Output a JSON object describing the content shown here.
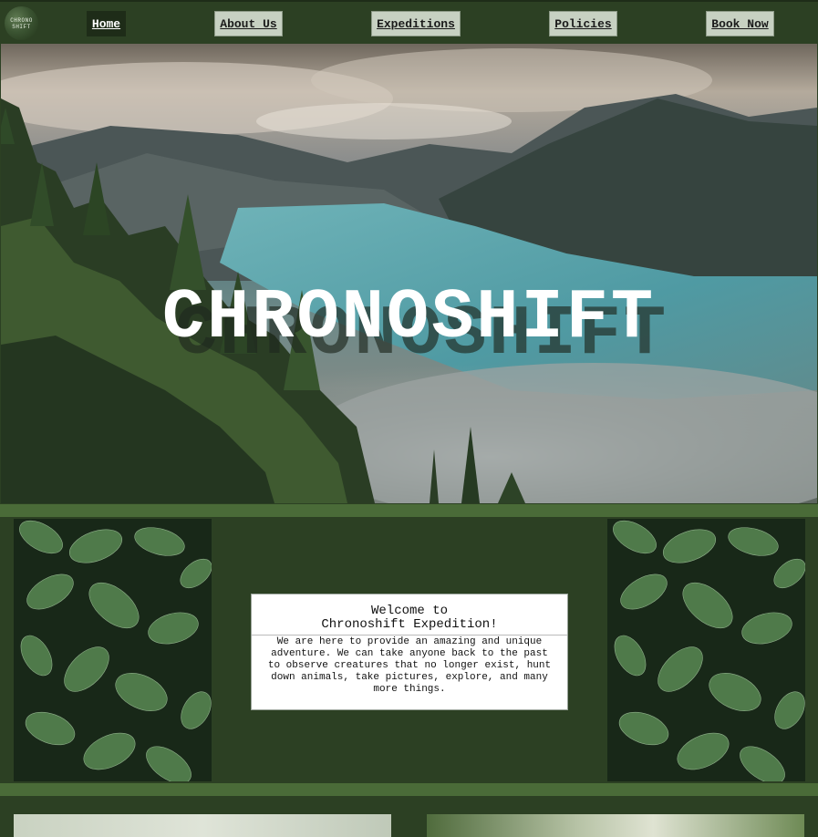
{
  "nav": {
    "logo_line1": "CHRONO",
    "logo_line2": "SHIFT",
    "items": [
      {
        "label": "Home",
        "active": true
      },
      {
        "label": "About Us",
        "active": false
      },
      {
        "label": "Expeditions",
        "active": false
      },
      {
        "label": "Policies",
        "active": false
      },
      {
        "label": "Book Now",
        "active": false
      }
    ]
  },
  "hero": {
    "title": "CHRONOSHIFT"
  },
  "welcome": {
    "title_line1": "Welcome to",
    "title_line2": "Chronoshift Expedition!",
    "body": "We are here to provide an amazing and unique adventure. We can take anyone back to the past to observe creatures that no longer exist, hunt down animals, take pictures, explore, and many more things."
  },
  "colors": {
    "background": "#2c4023",
    "band": "#4a6b38",
    "nav_button": "#c7d1c2",
    "nav_active": "#1e2c18"
  }
}
